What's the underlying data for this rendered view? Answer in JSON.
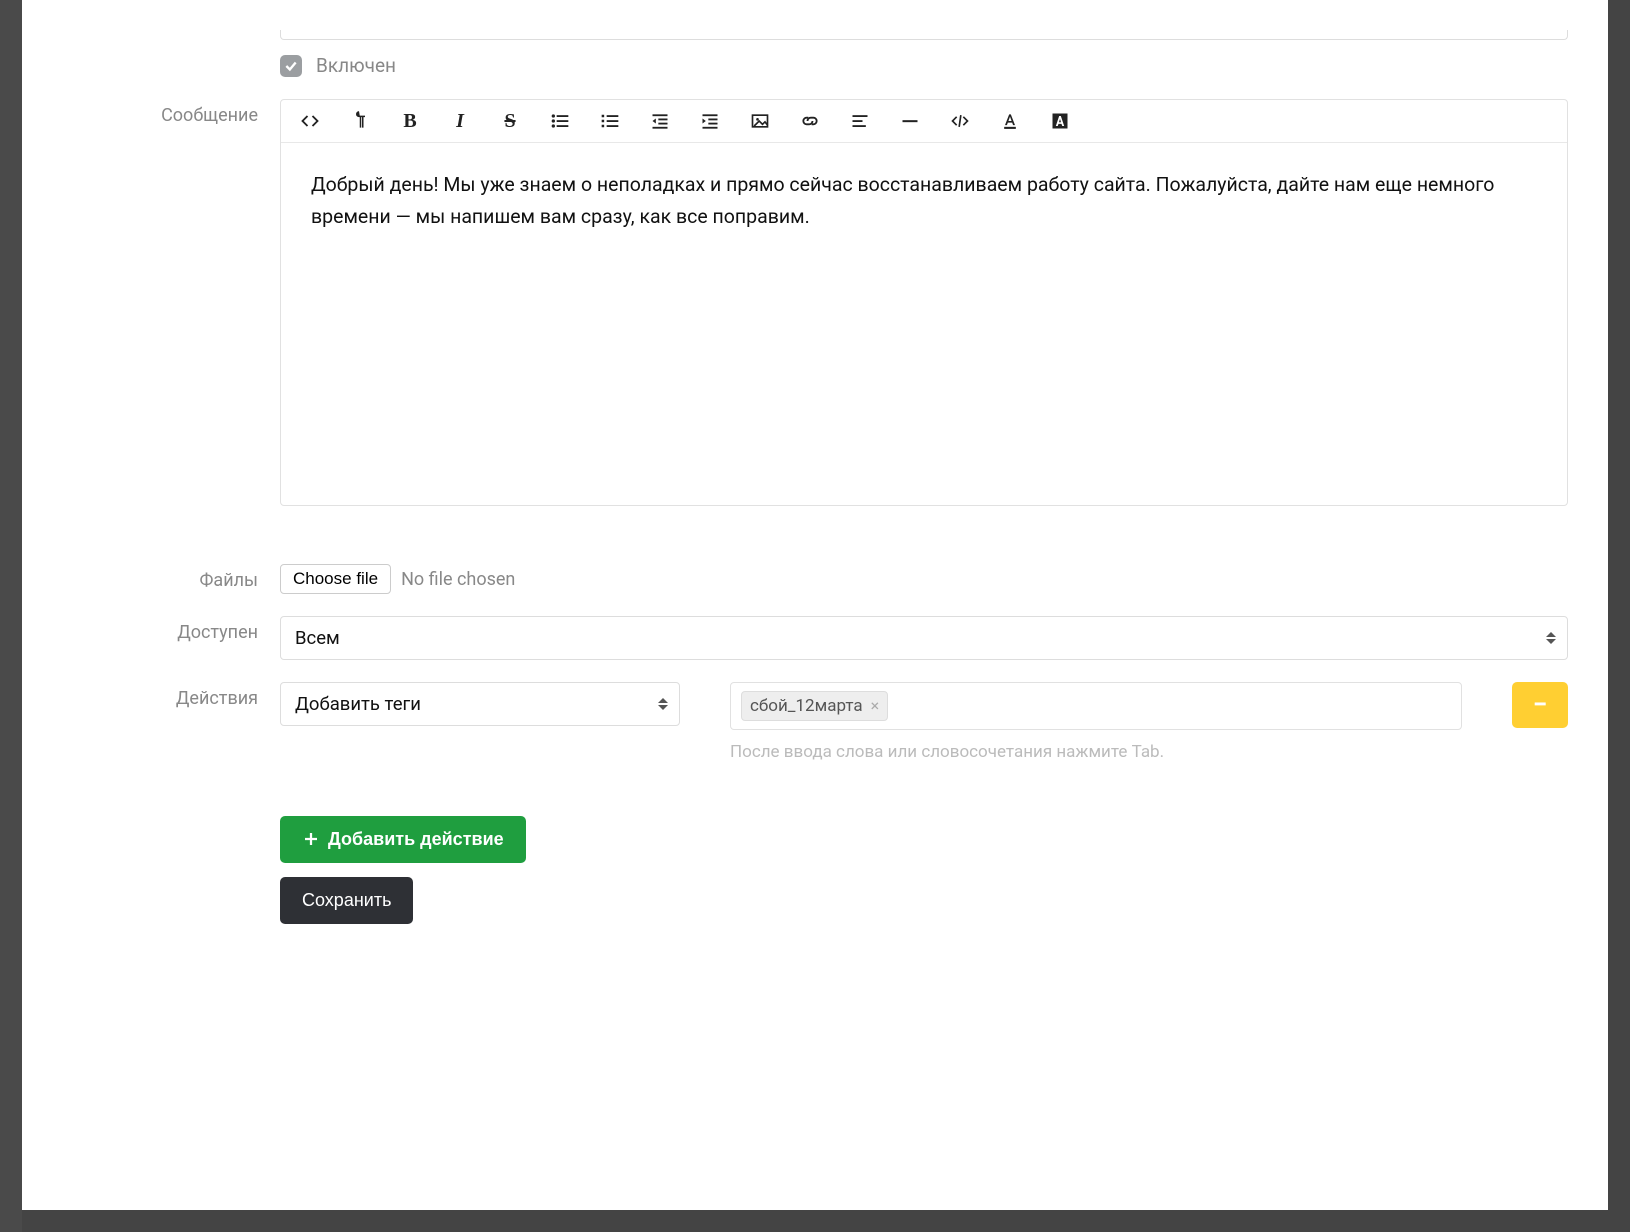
{
  "labels": {
    "included": "Включен",
    "message": "Сообщение",
    "files": "Файлы",
    "available": "Доступен",
    "actions": "Действия"
  },
  "editor": {
    "body": "Добрый день! Мы уже знаем о неполадках и прямо сейчас восстанавливаем работу сайта. Пожалуйста, дайте нам еще немного времени — мы напишем вам сразу, как все поправим."
  },
  "file": {
    "choose": "Choose file",
    "none": "No file chosen"
  },
  "available_select": {
    "value": "Всем"
  },
  "action_select": {
    "value": "Добавить теги"
  },
  "tags": {
    "items": [
      "сбой_12марта"
    ],
    "hint": "После ввода слова или словосочетания нажмите Tab."
  },
  "buttons": {
    "add_action": "Добавить действие",
    "save": "Сохранить"
  },
  "icons": {
    "minus": "−"
  }
}
